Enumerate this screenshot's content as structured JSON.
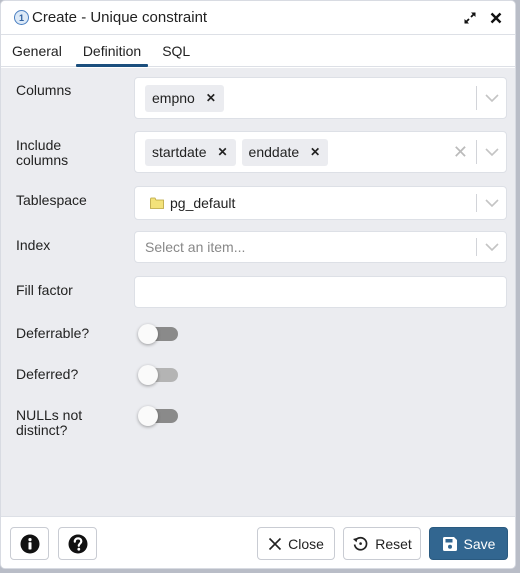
{
  "dialog": {
    "title": "Create - Unique constraint",
    "title_icon": "info-number-icon",
    "title_icon_glyph": "1",
    "window_buttons": [
      "expand-icon",
      "close-icon"
    ]
  },
  "tabs": [
    {
      "label": "General",
      "active": false
    },
    {
      "label": "Definition",
      "active": true
    },
    {
      "label": "SQL",
      "active": false
    }
  ],
  "form": {
    "columns": {
      "label": "Columns",
      "values": [
        "empno"
      ]
    },
    "include_columns": {
      "label": "Include columns",
      "values": [
        "startdate",
        "enddate"
      ]
    },
    "tablespace": {
      "label": "Tablespace",
      "value": "pg_default",
      "icon": "folder-icon"
    },
    "index": {
      "label": "Index",
      "placeholder": "Select an item..."
    },
    "fill_factor": {
      "label": "Fill factor",
      "value": ""
    },
    "deferrable": {
      "label": "Deferrable?",
      "value": false
    },
    "deferred": {
      "label": "Deferred?",
      "value": false,
      "disabled": true
    },
    "nulls_not_distinct": {
      "label": "NULLs not distinct?",
      "value": false
    }
  },
  "footer": {
    "info_icon": "info-icon",
    "help_icon": "help-icon",
    "close_label": "Close",
    "reset_label": "Reset",
    "save_label": "Save"
  },
  "colors": {
    "primary": "#326690",
    "tab_underline": "#1b4f7e",
    "content_bg": "#ebecf0",
    "folder": "#f3e27a"
  }
}
